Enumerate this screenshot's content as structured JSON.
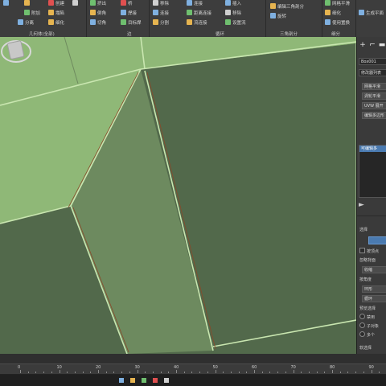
{
  "ribbon": {
    "items": [
      {
        "label": "",
        "color": "#7fb0e0"
      },
      {
        "label": "",
        "color": "#e6b450"
      },
      {
        "label": "创建",
        "color": "#e05050"
      },
      {
        "label": "附加",
        "color": "#6fbf6f"
      },
      {
        "label": "塌陷",
        "color": "#e6b450"
      },
      {
        "label": "分离",
        "color": "#7fb0e0"
      },
      {
        "label": "细化",
        "color": "#e6b450"
      },
      {
        "label": "",
        "color": "#d0d0d0"
      },
      {
        "label": "挤出",
        "color": "#6fbf6f"
      },
      {
        "label": "倒角",
        "color": "#e6b450"
      },
      {
        "label": "切角",
        "color": "#7fb0e0"
      },
      {
        "label": "桥",
        "color": "#e05050"
      },
      {
        "label": "焊接",
        "color": "#7fb0e0"
      },
      {
        "label": "目标焊",
        "color": "#6fbf6f"
      },
      {
        "label": "移除",
        "color": "#d0d0d0"
      },
      {
        "label": "连接",
        "color": "#7fb0e0"
      },
      {
        "label": "分割",
        "color": "#e6b450"
      },
      {
        "label": "连接",
        "color": "#7fb0e0"
      },
      {
        "label": "距离连接",
        "color": "#6fbf6f"
      },
      {
        "label": "流连接",
        "color": "#e6b450"
      },
      {
        "label": "插入",
        "color": "#7fb0e0"
      },
      {
        "label": "移除",
        "color": "#d0d0d0"
      },
      {
        "label": "设置流",
        "color": "#6fbf6f"
      },
      {
        "label": "编辑三角剖分",
        "color": "#e6b450"
      },
      {
        "label": "旋转",
        "color": "#7fb0e0"
      },
      {
        "label": "网格平滑",
        "color": "#6fbf6f"
      },
      {
        "label": "细化",
        "color": "#e6b450"
      },
      {
        "label": "使用置换",
        "color": "#7fb0e0"
      },
      {
        "label": "生成平面",
        "color": "#7fb0e0"
      }
    ],
    "group_labels": [
      "几何体(全部)",
      "边",
      "循环",
      "三角剖分",
      "细分"
    ]
  },
  "viewport": {
    "colors": {
      "face_dark": "#52694b",
      "face_mid": "#6d8a5f",
      "face_light": "#8fb877",
      "edge": "#c9e6b0",
      "seam": "#8a4a2a"
    }
  },
  "command_panel": {
    "tabs": [
      "+",
      "⌐",
      "▬"
    ],
    "object_name": "Box001",
    "modifier_list": "修改器列表",
    "modifiers": [
      "网格平滑",
      "涡轮平滑",
      "UVW 展开",
      "编辑多边形"
    ],
    "stack_item": "可编辑多",
    "section_selection": "选择",
    "by_vertex": "按顶点",
    "ignore_backfacing": "忽略背面",
    "by_angle": "按角度",
    "shrink": "收缩",
    "ring": "环形",
    "loop": "循环",
    "preview_selection": "预览选择",
    "disabled": "禁用",
    "subobject": "子对象",
    "multi": "多个",
    "soft_selection": "软选择"
  },
  "timeline": {
    "ticks": [
      "0",
      "10",
      "20",
      "30",
      "40",
      "50",
      "60",
      "70",
      "80",
      "90"
    ]
  }
}
